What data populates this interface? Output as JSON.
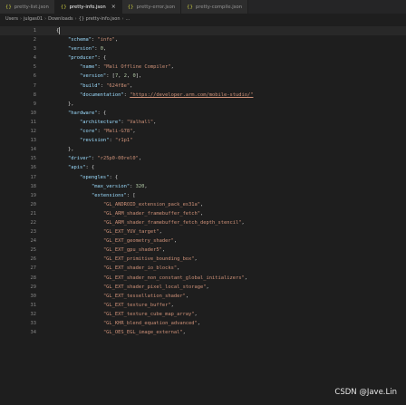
{
  "tabs": [
    {
      "label": "pretty-list.json",
      "active": false
    },
    {
      "label": "pretty-info.json",
      "active": true
    },
    {
      "label": "pretty-error.json",
      "active": false
    },
    {
      "label": "pretty-compile.json",
      "active": false
    }
  ],
  "tab_icon": "{}",
  "close_glyph": "×",
  "breadcrumb": [
    "Users",
    "julgas01",
    "Downloads",
    "{} pretty-info.json",
    "..."
  ],
  "watermark": "CSDN @Jave.Lin",
  "lines": [
    {
      "n": "1",
      "t": [
        [
          "p",
          "{"
        ]
      ]
    },
    {
      "n": "2",
      "t": [
        [
          "p",
          "    "
        ],
        [
          "k",
          "\"schema\""
        ],
        [
          "p",
          ": "
        ],
        [
          "s",
          "\"info\""
        ],
        [
          "p",
          ","
        ]
      ]
    },
    {
      "n": "3",
      "t": [
        [
          "p",
          "    "
        ],
        [
          "k",
          "\"version\""
        ],
        [
          "p",
          ": "
        ],
        [
          "n",
          "0"
        ],
        [
          "p",
          ","
        ]
      ]
    },
    {
      "n": "4",
      "t": [
        [
          "p",
          "    "
        ],
        [
          "k",
          "\"producer\""
        ],
        [
          "p",
          ": {"
        ]
      ]
    },
    {
      "n": "5",
      "t": [
        [
          "p",
          "        "
        ],
        [
          "k",
          "\"name\""
        ],
        [
          "p",
          ": "
        ],
        [
          "s",
          "\"Mali Offline Compiler\""
        ],
        [
          "p",
          ","
        ]
      ]
    },
    {
      "n": "6",
      "t": [
        [
          "p",
          "        "
        ],
        [
          "k",
          "\"version\""
        ],
        [
          "p",
          ": ["
        ],
        [
          "n",
          "7"
        ],
        [
          "p",
          ", "
        ],
        [
          "n",
          "2"
        ],
        [
          "p",
          ", "
        ],
        [
          "n",
          "0"
        ],
        [
          "p",
          "],"
        ]
      ]
    },
    {
      "n": "7",
      "t": [
        [
          "p",
          "        "
        ],
        [
          "k",
          "\"build\""
        ],
        [
          "p",
          ": "
        ],
        [
          "s",
          "\"624f8e\""
        ],
        [
          "p",
          ","
        ]
      ]
    },
    {
      "n": "8",
      "t": [
        [
          "p",
          "        "
        ],
        [
          "k",
          "\"documentation\""
        ],
        [
          "p",
          ": "
        ],
        [
          "u",
          "\"https://developer.arm.com/mobile-studio/\""
        ]
      ]
    },
    {
      "n": "9",
      "t": [
        [
          "p",
          "    },"
        ]
      ]
    },
    {
      "n": "10",
      "t": [
        [
          "p",
          "    "
        ],
        [
          "k",
          "\"hardware\""
        ],
        [
          "p",
          ": {"
        ]
      ]
    },
    {
      "n": "11",
      "t": [
        [
          "p",
          "        "
        ],
        [
          "k",
          "\"architecture\""
        ],
        [
          "p",
          ": "
        ],
        [
          "s",
          "\"Valhall\""
        ],
        [
          "p",
          ","
        ]
      ]
    },
    {
      "n": "12",
      "t": [
        [
          "p",
          "        "
        ],
        [
          "k",
          "\"core\""
        ],
        [
          "p",
          ": "
        ],
        [
          "s",
          "\"Mali-G78\""
        ],
        [
          "p",
          ","
        ]
      ]
    },
    {
      "n": "13",
      "t": [
        [
          "p",
          "        "
        ],
        [
          "k",
          "\"revision\""
        ],
        [
          "p",
          ": "
        ],
        [
          "s",
          "\"r1p1\""
        ]
      ]
    },
    {
      "n": "14",
      "t": [
        [
          "p",
          "    },"
        ]
      ]
    },
    {
      "n": "15",
      "t": [
        [
          "p",
          "    "
        ],
        [
          "k",
          "\"driver\""
        ],
        [
          "p",
          ": "
        ],
        [
          "s",
          "\"r25p0-00rel0\""
        ],
        [
          "p",
          ","
        ]
      ]
    },
    {
      "n": "16",
      "t": [
        [
          "p",
          "    "
        ],
        [
          "k",
          "\"apis\""
        ],
        [
          "p",
          ": {"
        ]
      ]
    },
    {
      "n": "17",
      "t": [
        [
          "p",
          "        "
        ],
        [
          "k",
          "\"opengles\""
        ],
        [
          "p",
          ": {"
        ]
      ]
    },
    {
      "n": "18",
      "t": [
        [
          "p",
          "            "
        ],
        [
          "k",
          "\"max_version\""
        ],
        [
          "p",
          ": "
        ],
        [
          "n",
          "320"
        ],
        [
          "p",
          ","
        ]
      ]
    },
    {
      "n": "19",
      "t": [
        [
          "p",
          "            "
        ],
        [
          "k",
          "\"extensions\""
        ],
        [
          "p",
          ": ["
        ]
      ]
    },
    {
      "n": "20",
      "t": [
        [
          "p",
          "                "
        ],
        [
          "s",
          "\"GL_ANDROID_extension_pack_es31a\""
        ],
        [
          "p",
          ","
        ]
      ]
    },
    {
      "n": "21",
      "t": [
        [
          "p",
          "                "
        ],
        [
          "s",
          "\"GL_ARM_shader_framebuffer_fetch\""
        ],
        [
          "p",
          ","
        ]
      ]
    },
    {
      "n": "22",
      "t": [
        [
          "p",
          "                "
        ],
        [
          "s",
          "\"GL_ARM_shader_framebuffer_fetch_depth_stencil\""
        ],
        [
          "p",
          ","
        ]
      ]
    },
    {
      "n": "23",
      "t": [
        [
          "p",
          "                "
        ],
        [
          "s",
          "\"GL_EXT_YUV_target\""
        ],
        [
          "p",
          ","
        ]
      ]
    },
    {
      "n": "24",
      "t": [
        [
          "p",
          "                "
        ],
        [
          "s",
          "\"GL_EXT_geometry_shader\""
        ],
        [
          "p",
          ","
        ]
      ]
    },
    {
      "n": "25",
      "t": [
        [
          "p",
          "                "
        ],
        [
          "s",
          "\"GL_EXT_gpu_shader5\""
        ],
        [
          "p",
          ","
        ]
      ]
    },
    {
      "n": "26",
      "t": [
        [
          "p",
          "                "
        ],
        [
          "s",
          "\"GL_EXT_primitive_bounding_box\""
        ],
        [
          "p",
          ","
        ]
      ]
    },
    {
      "n": "27",
      "t": [
        [
          "p",
          "                "
        ],
        [
          "s",
          "\"GL_EXT_shader_io_blocks\""
        ],
        [
          "p",
          ","
        ]
      ]
    },
    {
      "n": "28",
      "t": [
        [
          "p",
          "                "
        ],
        [
          "s",
          "\"GL_EXT_shader_non_constant_global_initializers\""
        ],
        [
          "p",
          ","
        ]
      ]
    },
    {
      "n": "29",
      "t": [
        [
          "p",
          "                "
        ],
        [
          "s",
          "\"GL_EXT_shader_pixel_local_storage\""
        ],
        [
          "p",
          ","
        ]
      ]
    },
    {
      "n": "30",
      "t": [
        [
          "p",
          "                "
        ],
        [
          "s",
          "\"GL_EXT_tessellation_shader\""
        ],
        [
          "p",
          ","
        ]
      ]
    },
    {
      "n": "31",
      "t": [
        [
          "p",
          "                "
        ],
        [
          "s",
          "\"GL_EXT_texture_buffer\""
        ],
        [
          "p",
          ","
        ]
      ]
    },
    {
      "n": "32",
      "t": [
        [
          "p",
          "                "
        ],
        [
          "s",
          "\"GL_EXT_texture_cube_map_array\""
        ],
        [
          "p",
          ","
        ]
      ]
    },
    {
      "n": "33",
      "t": [
        [
          "p",
          "                "
        ],
        [
          "s",
          "\"GL_KHR_blend_equation_advanced\""
        ],
        [
          "p",
          ","
        ]
      ]
    },
    {
      "n": "34",
      "t": [
        [
          "p",
          "                "
        ],
        [
          "s",
          "\"GL_OES_EGL_image_external\""
        ],
        [
          "p",
          ","
        ]
      ]
    }
  ]
}
